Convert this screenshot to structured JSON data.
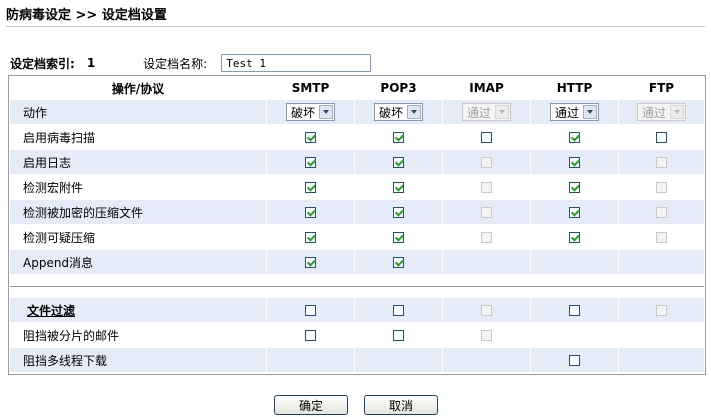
{
  "page": {
    "title": "防病毒设定 >> 设定档设置"
  },
  "profile": {
    "index_label": "设定档索引:",
    "index_value": "1",
    "name_label": "设定档名称:",
    "name_value": "Test 1"
  },
  "table": {
    "header": {
      "operation": "操作/协议",
      "smtp": "SMTP",
      "pop3": "POP3",
      "imap": "IMAP",
      "http": "HTTP",
      "ftp": "FTP"
    },
    "action_row": {
      "label": "动作",
      "smtp": "破坏",
      "pop3": "破坏",
      "imap": "通过",
      "http": "通过",
      "ftp": "通过"
    },
    "rows": [
      {
        "label": "启用病毒扫描"
      },
      {
        "label": "启用日志"
      },
      {
        "label": "检测宏附件"
      },
      {
        "label": "检测被加密的压缩文件"
      },
      {
        "label": "检测可疑压缩"
      },
      {
        "label": "Append消息"
      }
    ],
    "file_filter": {
      "label": "文件过滤"
    },
    "block_fragmented": {
      "label": "阻挡被分片的邮件"
    },
    "block_multithread": {
      "label": "阻挡多线程下载"
    }
  },
  "buttons": {
    "ok": "确定",
    "cancel": "取消"
  },
  "colors": {
    "row_shade": "#e6ecf7",
    "check_mark": "#21a121",
    "border": "#9a9a9a"
  }
}
